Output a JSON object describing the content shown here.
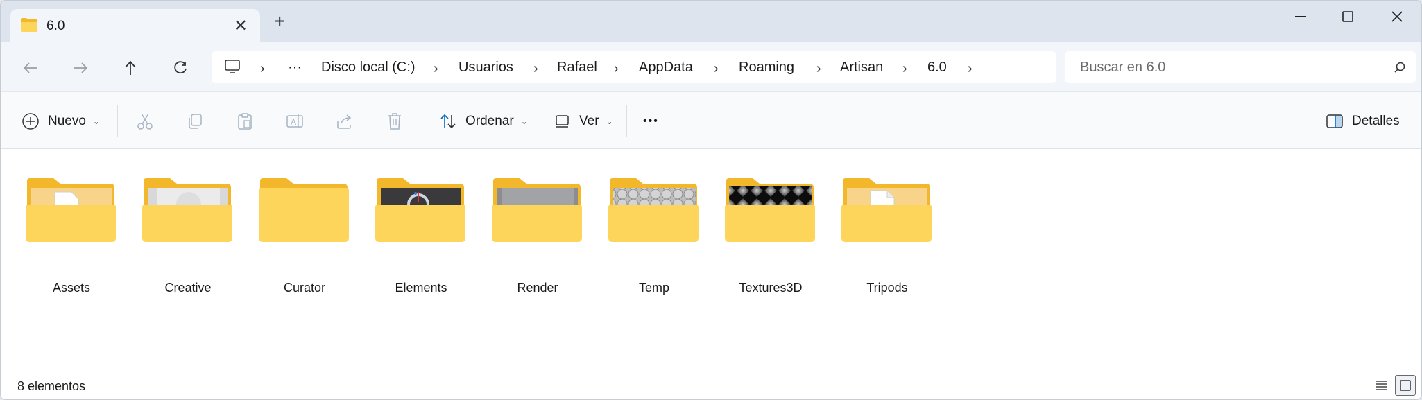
{
  "tab": {
    "title": "6.0"
  },
  "breadcrumb": {
    "overflow": "···",
    "items": [
      "Disco local (C:)",
      "Usuarios",
      "Rafael",
      "AppData",
      "Roaming",
      "Artisan",
      "6.0"
    ]
  },
  "search": {
    "placeholder": "Buscar en 6.0"
  },
  "toolbar": {
    "new_label": "Nuevo",
    "sort_label": "Ordenar",
    "view_label": "Ver",
    "more_label": "•••",
    "details_label": "Detalles"
  },
  "folders": [
    {
      "name": "Assets",
      "preview": "json-file"
    },
    {
      "name": "Creative",
      "preview": "gray-image"
    },
    {
      "name": "Curator",
      "preview": "empty"
    },
    {
      "name": "Elements",
      "preview": "dark-image"
    },
    {
      "name": "Render",
      "preview": "gray-panel"
    },
    {
      "name": "Temp",
      "preview": "circles-pattern"
    },
    {
      "name": "Textures3D",
      "preview": "diamond-pattern"
    },
    {
      "name": "Tripods",
      "preview": "blank-file"
    }
  ],
  "status": {
    "count_text": "8 elementos"
  },
  "colors": {
    "folder_back": "#f3b72b",
    "folder_front": "#fcd55a",
    "accent": "#0067c0"
  }
}
